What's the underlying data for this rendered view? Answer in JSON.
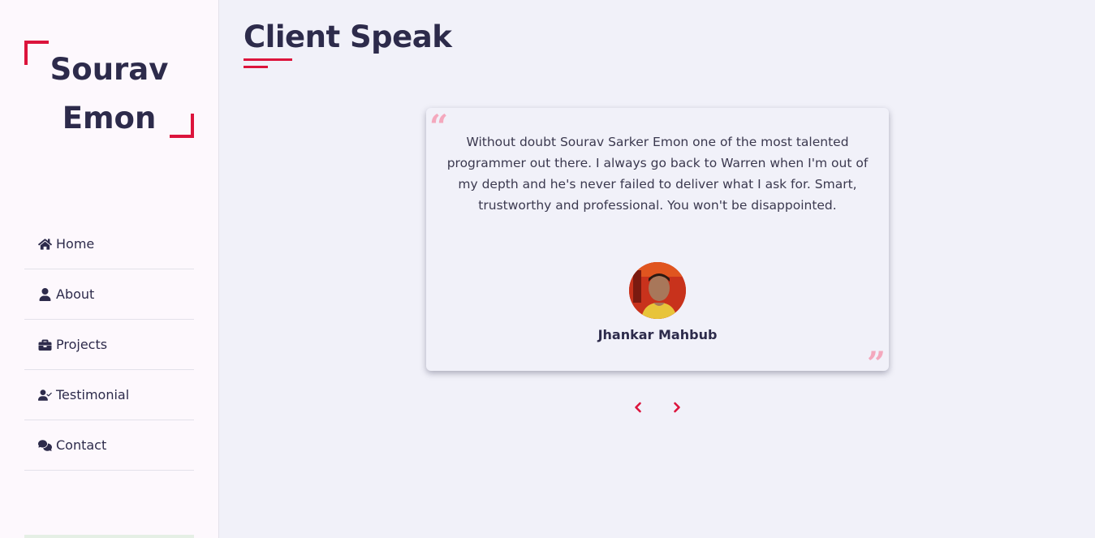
{
  "brand": {
    "name_line1": "Sourav",
    "name_line2": "Emon"
  },
  "sidebar": {
    "items": [
      {
        "label": "Home",
        "icon": "home-icon"
      },
      {
        "label": "About",
        "icon": "user-icon"
      },
      {
        "label": "Projects",
        "icon": "briefcase-icon"
      },
      {
        "label": "Testimonial",
        "icon": "user-check-icon"
      },
      {
        "label": "Contact",
        "icon": "comments-icon"
      }
    ]
  },
  "main": {
    "section_title": "Client Speak",
    "testimonial": {
      "text": "Without doubt Sourav Sarker Emon one of the most talented programmer out there. I always go back to Warren when I'm out of my depth and he's never failed to deliver what I ask for. Smart, trustworthy and professional. You won't be disappointed.",
      "client_name": "Jhankar Mahbub"
    },
    "carousel": {
      "prev_icon": "chevron-left-icon",
      "next_icon": "chevron-right-icon"
    }
  },
  "colors": {
    "accent": "#dc143c",
    "text": "#2d2b4b",
    "background": "#f1f1f9",
    "sidebar_background": "#fdf8fd",
    "quote_mark": "#f4a8bd"
  }
}
